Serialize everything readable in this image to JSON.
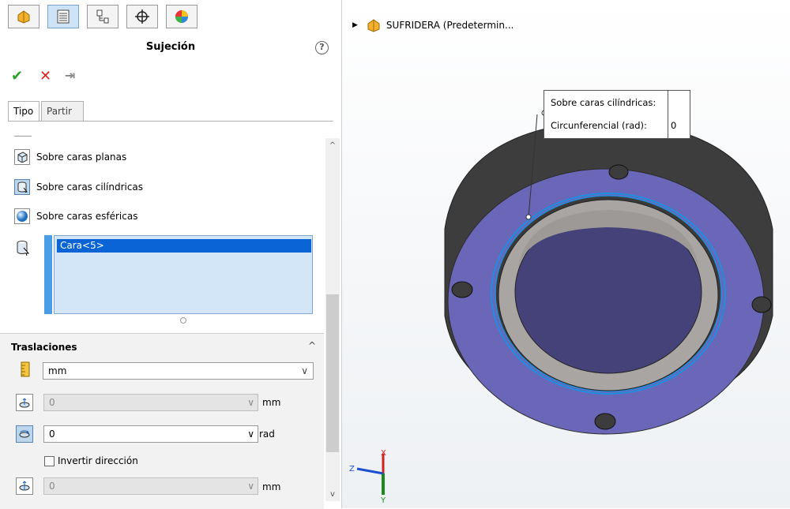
{
  "panel": {
    "title": "Sujeción",
    "help_symbol": "?",
    "tabs": [
      {
        "name": "feature-manager-tab",
        "icon": "part-icon"
      },
      {
        "name": "property-manager-tab",
        "icon": "property-list-icon",
        "active": true
      },
      {
        "name": "configuration-manager-tab",
        "icon": "configuration-icon"
      },
      {
        "name": "dimxpert-tab",
        "icon": "crosshair-icon"
      },
      {
        "name": "display-manager-tab",
        "icon": "appearance-sphere-icon"
      }
    ],
    "toolbar": {
      "ok_symbol": "✔",
      "cancel_symbol": "✕",
      "pin_symbol": "⇥"
    },
    "subtabs": [
      "Tipo",
      "Partir"
    ],
    "options": [
      "Sobre caras planas",
      "Sobre caras cilíndricas",
      "Sobre caras esféricas"
    ],
    "selection_list": [
      "Cara<5>"
    ],
    "translations": {
      "title": "Traslaciones",
      "unit_select": "mm",
      "rows": [
        {
          "value": "0",
          "unit": "mm",
          "enabled": false
        },
        {
          "value": "0",
          "unit": "rad",
          "enabled": true
        },
        {
          "value": "0",
          "unit": "mm",
          "enabled": false
        }
      ],
      "invert_label": "Invertir dirección",
      "invert_checked": false
    }
  },
  "view": {
    "tree_label": "SUFRIDERA  (Predetermin...",
    "callout": {
      "row1": "Sobre caras cilíndricas:",
      "row2_label": "Circunferencial (rad):",
      "row2_value": "0"
    },
    "axes": {
      "x": "X",
      "y": "Y",
      "z": "Z"
    },
    "colors": {
      "ring_face": "#6a66b8",
      "inner_ring": "#a9a5a2",
      "outer_wall": "#3d3d3d",
      "selected_edge": "#1e8fe0"
    }
  }
}
